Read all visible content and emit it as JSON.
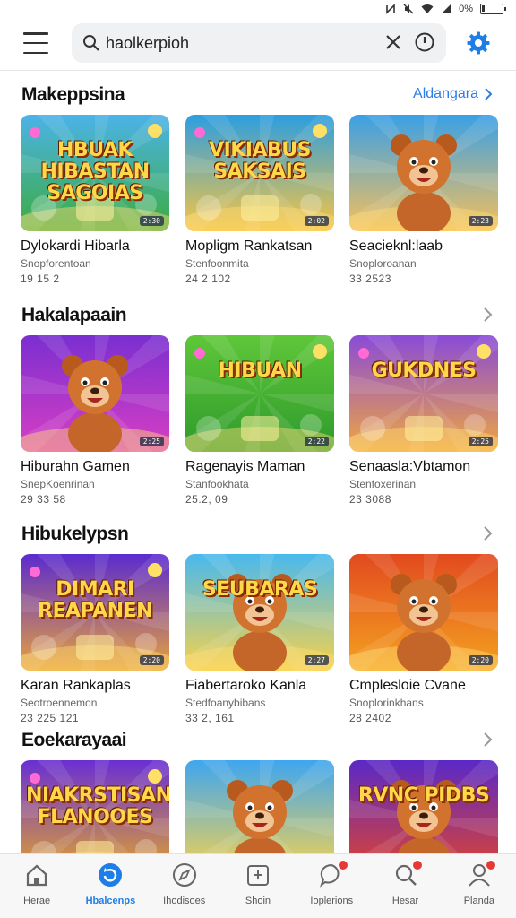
{
  "status": {
    "battery_text": "0%",
    "battery_level": 0.12
  },
  "search": {
    "value": "haolkerpioh",
    "placeholder": ""
  },
  "sections": [
    {
      "title": "Makeppsina",
      "link": "Aldangara",
      "items": [
        {
          "name": "Dylokardi Hibarla",
          "sub": "Snopforentoan",
          "meta": "19 15 2",
          "thumb_text": "HBUAK HIBASTAN SAGOIAS",
          "badge": "2:30",
          "colors": [
            "#4bb3e8",
            "#3cab3f"
          ],
          "icon": "game-thumbnail"
        },
        {
          "name": "Mopligm Rankatsan",
          "sub": "Stenfoonmita",
          "meta": "24 2 102",
          "thumb_text": "VIKIABUS SAKSAIS",
          "badge": "2:02",
          "colors": [
            "#2d9ee0",
            "#f8c542"
          ],
          "icon": "game-thumbnail"
        },
        {
          "name": "Seacieknl:laab",
          "sub": "Snoploroanan",
          "meta": "33 2523",
          "thumb_text": "",
          "badge": "2:23",
          "colors": [
            "#3aa0e6",
            "#f6c05a"
          ],
          "icon": "bear-thumbnail"
        }
      ]
    },
    {
      "title": "Hakalapaain",
      "link": "",
      "items": [
        {
          "name": "Hiburahn Gamen",
          "sub": "SnepKoenrinan",
          "meta": "29 33 58",
          "thumb_text": "",
          "badge": "2:25",
          "colors": [
            "#7a2fd1",
            "#d93ec3"
          ],
          "icon": "bear-thumbnail"
        },
        {
          "name": "Ragenayis Maman",
          "sub": "Stanfookhata",
          "meta": "25.2, 09",
          "thumb_text": "HIBUAN",
          "badge": "2:22",
          "colors": [
            "#5fc739",
            "#2e9a2c"
          ],
          "icon": "game-thumbnail"
        },
        {
          "name": "Senaasla:Vbtamon",
          "sub": "Stenfoxerinan",
          "meta": "23 3088",
          "thumb_text": "GUKDNES",
          "badge": "2:25",
          "colors": [
            "#8a4bd8",
            "#f0a63e"
          ],
          "icon": "game-thumbnail"
        }
      ]
    },
    {
      "title": "Hibukelypsn",
      "link": "",
      "items": [
        {
          "name": "Karan Rankaplas",
          "sub": "Seotroennemon",
          "meta": "23 225 121",
          "thumb_text": "DIMARI REAPANEN",
          "badge": "2:20",
          "colors": [
            "#5b2bd0",
            "#e8a23a"
          ],
          "icon": "game-thumbnail"
        },
        {
          "name": "Fiabertaroko Kanla",
          "sub": "Stedfoanybibans",
          "meta": "33 2, 161",
          "thumb_text": "SEUBARAS",
          "badge": "2:27",
          "colors": [
            "#49b9ee",
            "#f7d24a"
          ],
          "icon": "bear-thumbnail"
        },
        {
          "name": "Cmplesloie Cvane",
          "sub": "Snoplorinkhans",
          "meta": "28 2402",
          "thumb_text": "",
          "badge": "2:20",
          "colors": [
            "#e24a1f",
            "#f4a21f"
          ],
          "icon": "bear-thumbnail"
        }
      ]
    },
    {
      "title": "Eoekarayaai",
      "link": "",
      "items": [
        {
          "name": "",
          "sub": "",
          "meta": "",
          "thumb_text": "NIAKRSTISAN FLANOOES",
          "badge": "",
          "colors": [
            "#6a2fd4",
            "#e3a52a"
          ],
          "icon": "game-thumbnail"
        },
        {
          "name": "",
          "sub": "",
          "meta": "",
          "thumb_text": "",
          "badge": "",
          "colors": [
            "#3ea6f0",
            "#f9d34d"
          ],
          "icon": "bear-thumbnail"
        },
        {
          "name": "",
          "sub": "",
          "meta": "",
          "thumb_text": "RVNC PIDBS",
          "badge": "",
          "colors": [
            "#5a28c8",
            "#e2452a"
          ],
          "icon": "bear-thumbnail"
        }
      ]
    }
  ],
  "nav": [
    {
      "label": "Herae",
      "icon": "home-icon",
      "active": false,
      "dot": false
    },
    {
      "label": "Hbalcenps",
      "icon": "refresh-icon",
      "active": true,
      "dot": false
    },
    {
      "label": "Ihodisoes",
      "icon": "compass-icon",
      "active": false,
      "dot": false
    },
    {
      "label": "Shoin",
      "icon": "store-icon",
      "active": false,
      "dot": false
    },
    {
      "label": "Ioplerions",
      "icon": "chat-icon",
      "active": false,
      "dot": true
    },
    {
      "label": "Hesar",
      "icon": "search-icon",
      "active": false,
      "dot": true
    },
    {
      "label": "Planda",
      "icon": "profile-icon",
      "active": false,
      "dot": true
    }
  ],
  "colors": {
    "accent": "#1f7de6",
    "badge": "#e53935"
  }
}
